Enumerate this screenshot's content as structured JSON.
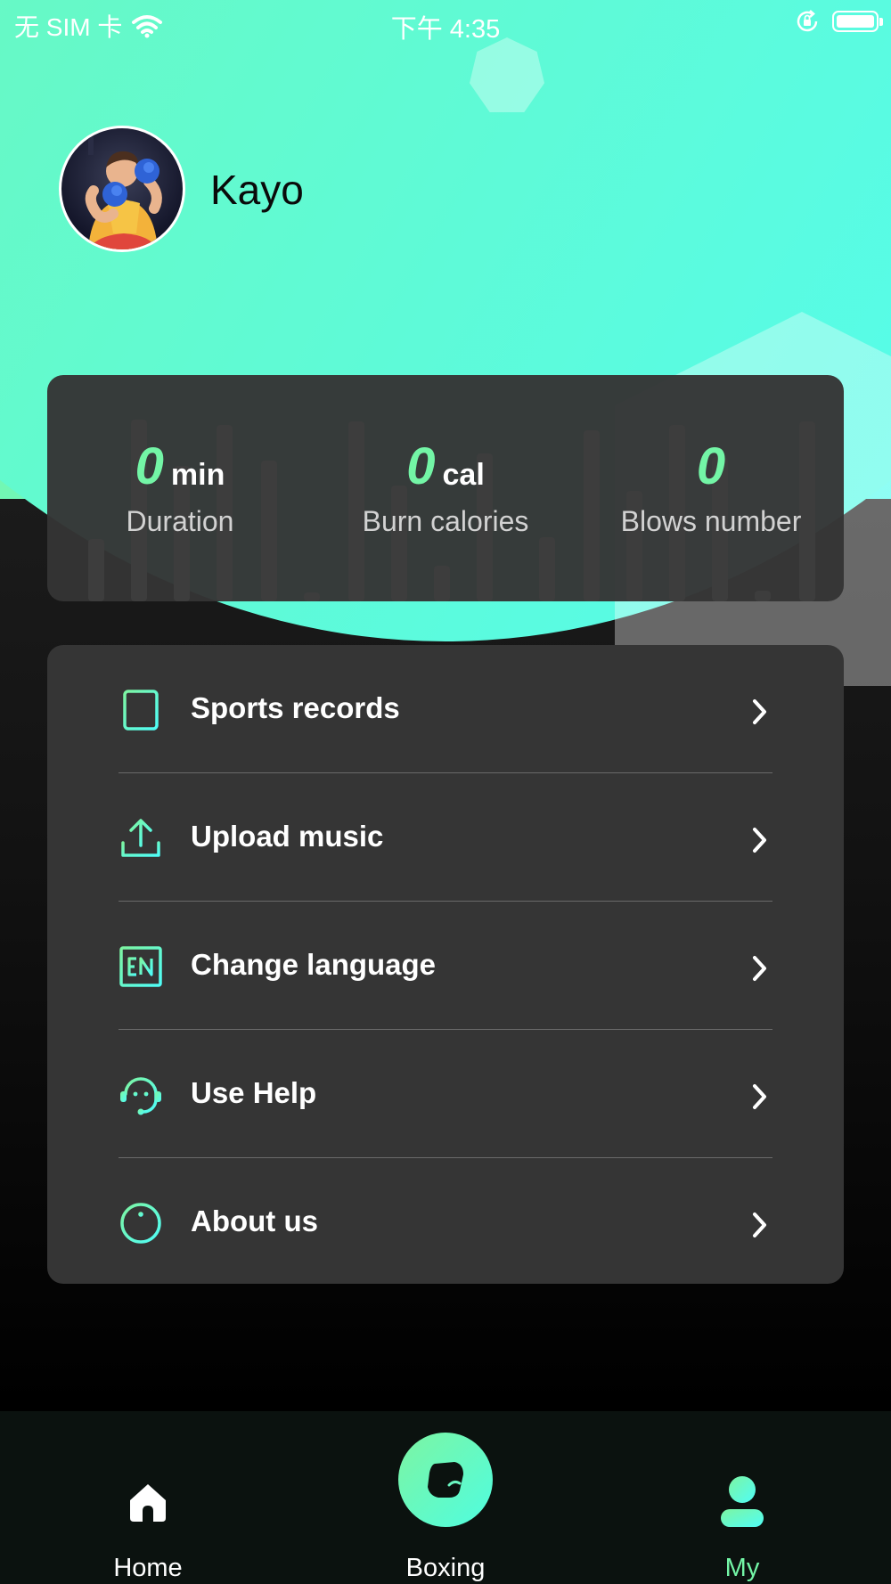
{
  "status_bar": {
    "carrier": "无 SIM 卡",
    "time": "下午 4:35",
    "icons": [
      "wifi-icon",
      "orientation-lock-icon",
      "battery-icon"
    ]
  },
  "profile": {
    "username": "Kayo",
    "avatar": "boxer-avatar"
  },
  "stats": [
    {
      "value": "0",
      "unit": "min",
      "label": "Duration"
    },
    {
      "value": "0",
      "unit": "cal",
      "label": "Burn calories"
    },
    {
      "value": "0",
      "unit": "",
      "label": "Blows number"
    }
  ],
  "menu": [
    {
      "label": "Sports records",
      "icon": "document-icon"
    },
    {
      "label": "Upload music",
      "icon": "upload-icon"
    },
    {
      "label": "Change language",
      "icon": "language-en-icon"
    },
    {
      "label": "Use Help",
      "icon": "headset-icon"
    },
    {
      "label": "About us",
      "icon": "info-icon"
    }
  ],
  "tabs": [
    {
      "label": "Home",
      "icon": "home-icon"
    },
    {
      "label": "Boxing",
      "icon": "boxing-glove-icon"
    },
    {
      "label": "My",
      "icon": "user-icon",
      "active": true
    }
  ],
  "colors": {
    "accent": "#73f5a6",
    "gradient_start": "#7df5a2",
    "gradient_end": "#4ffdf7",
    "card": "#353535",
    "tab_bar": "#0b120f"
  }
}
